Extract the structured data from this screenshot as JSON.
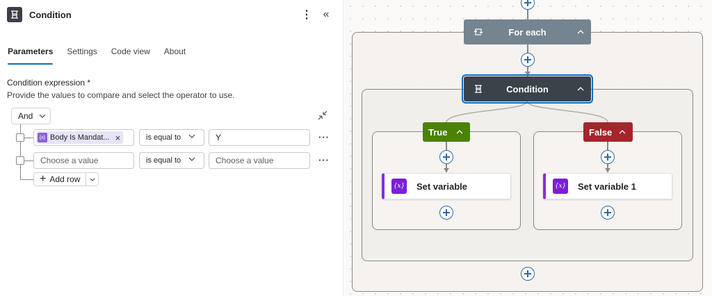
{
  "panel": {
    "title": "Condition",
    "more_icon": "more-vertical-icon",
    "collapse_icon": "double-chevron-left-icon",
    "tabs": [
      {
        "label": "Parameters",
        "active": true
      },
      {
        "label": "Settings",
        "active": false
      },
      {
        "label": "Code view",
        "active": false
      },
      {
        "label": "About",
        "active": false
      }
    ],
    "condition_label": "Condition expression *",
    "condition_help": "Provide the values to compare and select the operator to use.",
    "group_operator": "And",
    "rows": [
      {
        "left_token": "Body Is Mandat...",
        "operator": "is equal to",
        "right_value": "Y",
        "right_placeholder": ""
      },
      {
        "left_placeholder": "Choose a value",
        "operator": "is equal to",
        "right_value": "",
        "right_placeholder": "Choose a value"
      }
    ],
    "row_more": "···",
    "add_row_label": "Add row"
  },
  "canvas": {
    "foreach_label": "For each",
    "condition_label": "Condition",
    "true_label": "True",
    "false_label": "False",
    "true_action_label": "Set variable",
    "false_action_label": "Set variable 1",
    "action_icon_text": "{x}",
    "token_icon_text": "{x}",
    "colors": {
      "foreach": "#758491",
      "condition": "#3b424a",
      "true": "#498205",
      "false": "#a4262c",
      "variable": "#7b1fd7",
      "accent": "#0f6cbd"
    }
  }
}
